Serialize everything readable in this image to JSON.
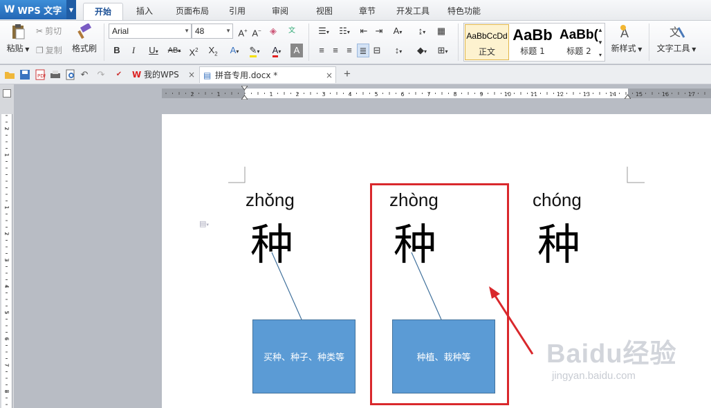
{
  "app": {
    "name": "WPS 文字"
  },
  "menu": {
    "tabs": [
      "开始",
      "插入",
      "页面布局",
      "引用",
      "审阅",
      "视图",
      "章节",
      "开发工具",
      "特色功能"
    ],
    "active_index": 0
  },
  "ribbon": {
    "paste_label": "粘贴",
    "cut_label": "剪切",
    "copy_label": "复制",
    "format_painter_label": "格式刷",
    "font_name": "Arial",
    "font_size": "48",
    "styles": [
      {
        "sample": "AaBbCcDd",
        "name": "正文"
      },
      {
        "sample": "AaBb",
        "name": "标题 1"
      },
      {
        "sample": "AaBb(",
        "name": "标题 2"
      }
    ],
    "new_style_label": "新样式",
    "text_tools_label": "文字工具"
  },
  "doc_tabs": [
    {
      "label": "我的WPS",
      "close": "×"
    },
    {
      "label": "拼音专用.docx *",
      "close": "×"
    }
  ],
  "new_tab_symbol": "+",
  "ruler": {
    "h_ticks": [
      "2",
      "1",
      "1",
      "2",
      "3",
      "4",
      "5",
      "6",
      "7",
      "8",
      "9",
      "10",
      "11",
      "12",
      "13",
      "14",
      "15",
      "16",
      "17"
    ],
    "v_ticks": [
      "2",
      "1",
      "1",
      "2",
      "3",
      "4",
      "5",
      "6",
      "7",
      "8",
      "9"
    ]
  },
  "document": {
    "entries": [
      {
        "pinyin": "zhǒng",
        "hanzi": "种",
        "callout": "买种、种子、种类等"
      },
      {
        "pinyin": "zhòng",
        "hanzi": "种",
        "callout": "种植、栽种等"
      },
      {
        "pinyin": "chóng",
        "hanzi": "种"
      }
    ]
  },
  "watermark": {
    "brand": "Baidu经验",
    "url": "jingyan.baidu.com"
  },
  "colors": {
    "accent": "#2467b5",
    "callout_fill": "#5b9bd5",
    "highlight": "#d9282c"
  }
}
